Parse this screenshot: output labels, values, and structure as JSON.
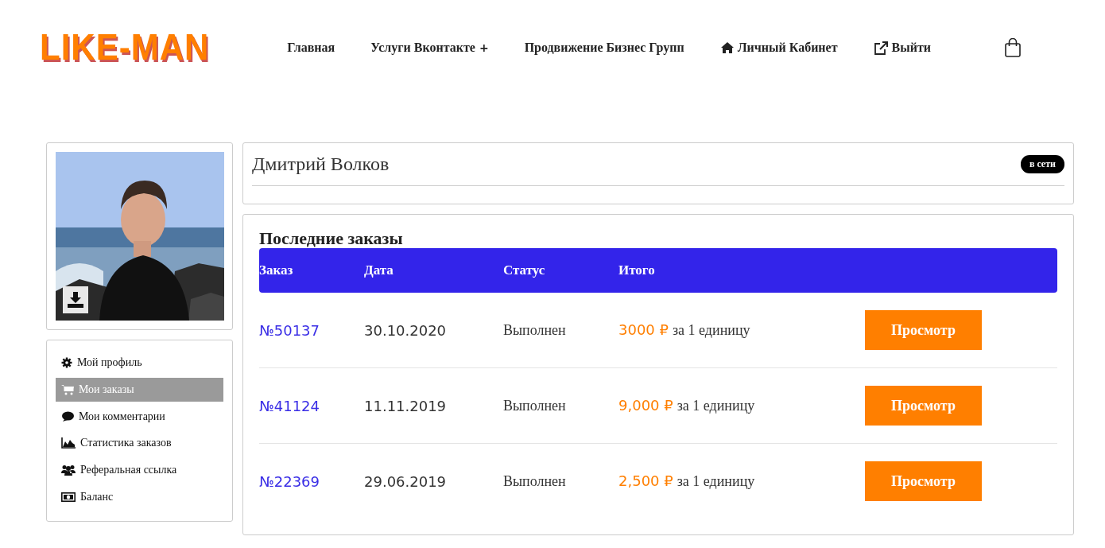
{
  "logo": "LIKE-MAN",
  "nav": [
    {
      "label": "Главная"
    },
    {
      "label": "Услуги Вконтакте",
      "suffix": "+"
    },
    {
      "label": "Продвижение Бизнес Групп"
    },
    {
      "label": "Личный Кабинет"
    },
    {
      "label": "Выйти"
    }
  ],
  "profile": {
    "name": "Дмитрий Волков",
    "status": "в сети"
  },
  "sidebar": {
    "items": [
      {
        "label": "Мой профиль",
        "selected": false
      },
      {
        "label": "Мои заказы",
        "selected": true
      },
      {
        "label": "Мои комментарии",
        "selected": false
      },
      {
        "label": "Статистика заказов",
        "selected": false
      },
      {
        "label": "Реферальная ссылка",
        "selected": false
      },
      {
        "label": "Баланс",
        "selected": false
      }
    ]
  },
  "orders": {
    "title": "Последние заказы",
    "columns": [
      "Заказ",
      "Дата",
      "Статус",
      "Итого"
    ],
    "rows": [
      {
        "number": "№50137",
        "date": "30.10.2020",
        "status": "Выполнен",
        "price": "3000 ₽",
        "unit": "за 1 единицу",
        "action": "Просмотр"
      },
      {
        "number": "№41124",
        "date": "11.11.2019",
        "status": "Выполнен",
        "price": "9,000 ₽",
        "unit": "за 1 единицу",
        "action": "Просмотр"
      },
      {
        "number": "№22369",
        "date": "29.06.2019",
        "status": "Выполнен",
        "price": "2,500 ₽",
        "unit": "за 1 единицу",
        "action": "Просмотр"
      }
    ]
  }
}
